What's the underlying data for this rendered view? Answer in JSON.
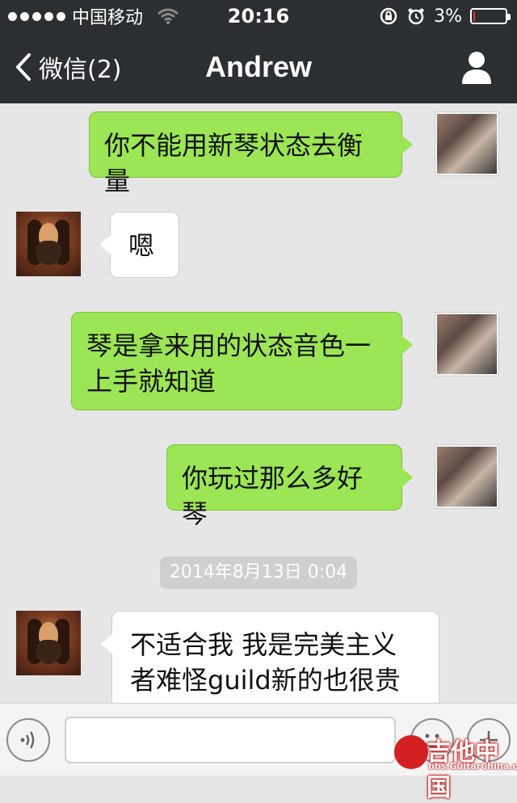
{
  "status": {
    "carrier": "中国移动",
    "time": "20:16",
    "battery": "3%",
    "battery_level": 0.03
  },
  "nav": {
    "back_label": "微信(2)",
    "title": "Andrew"
  },
  "messages": [
    {
      "side": "out",
      "text": "你不能用新琴状态去衡量"
    },
    {
      "side": "in",
      "text": "嗯"
    },
    {
      "side": "out",
      "text": "琴是拿来用的状态音色一上手就知道"
    },
    {
      "side": "out",
      "text": "你玩过那么多好琴"
    },
    {
      "side": "in",
      "text": "不适合我 我是完美主义者难怪guild新的也很贵"
    }
  ],
  "timestamp": "2014年8月13日 0:04",
  "input": {
    "value": "",
    "placeholder": ""
  },
  "watermark": {
    "text": "吉他中国",
    "url": "bbs.GuitarChina.com"
  },
  "icons": {
    "signal": "signal-dots-icon",
    "wifi": "wifi-icon",
    "lock": "rotation-lock-icon",
    "alarm": "alarm-icon",
    "back": "chevron-left-icon",
    "profile": "person-icon",
    "voice": "voice-icon",
    "emoji": "emoji-icon",
    "plus": "plus-icon"
  },
  "colors": {
    "topbar": "#2b2f32",
    "out_bubble": "#9ce554",
    "in_bubble": "#ffffff",
    "background": "#e6e6e6"
  }
}
